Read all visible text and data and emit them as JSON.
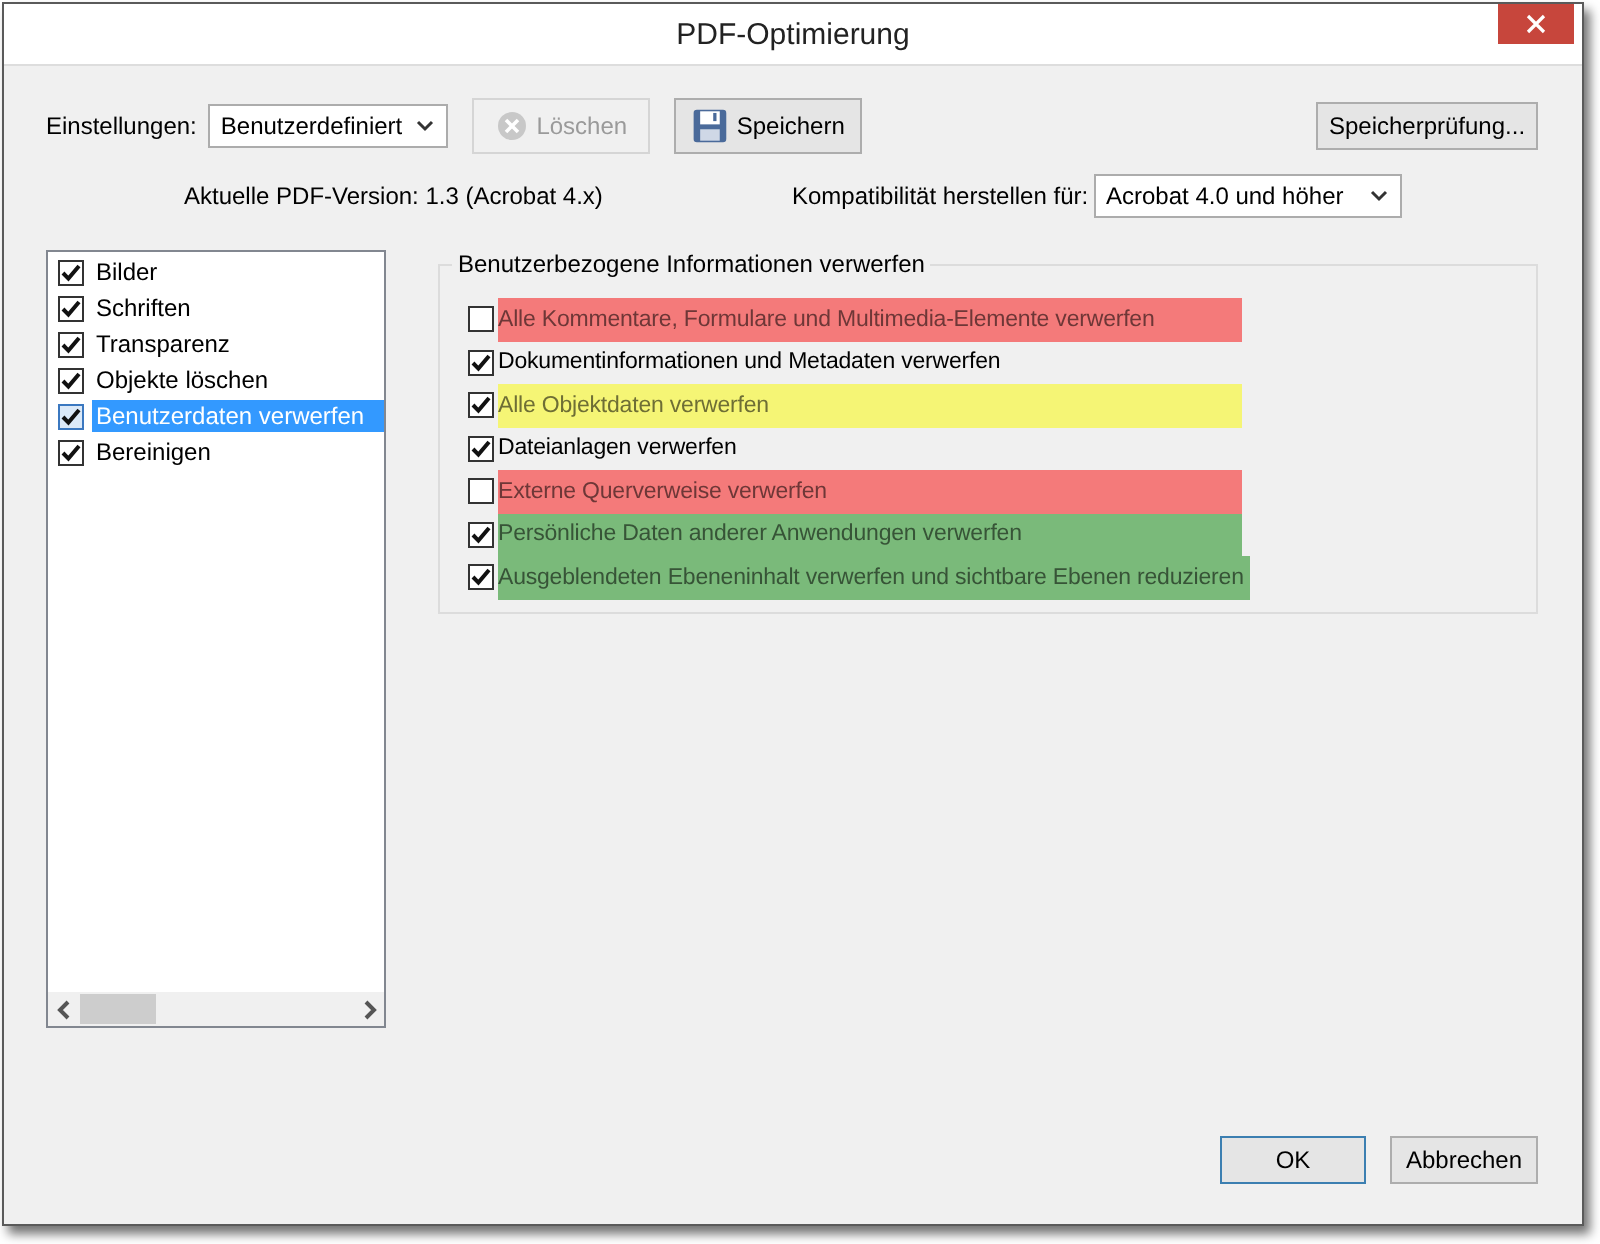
{
  "window": {
    "title": "PDF-Optimierung"
  },
  "settings": {
    "label": "Einstellungen:",
    "value": "Benutzerdefiniert"
  },
  "toolbar_buttons": [
    {
      "label": "Löschen",
      "kind": "delete",
      "disabled": true
    },
    {
      "label": "Speichern",
      "kind": "save",
      "disabled": false
    }
  ],
  "memory_button": "Speicherprüfung...",
  "pdf_version": "Aktuelle PDF-Version: 1.3 (Acrobat 4.x)",
  "compatibility": {
    "label": "Kompatibilität herstellen für:",
    "value": "Acrobat 4.0 und höher"
  },
  "categories": [
    {
      "label": "Bilder",
      "checked": true,
      "selected": false
    },
    {
      "label": "Schriften",
      "checked": true,
      "selected": false
    },
    {
      "label": "Transparenz",
      "checked": true,
      "selected": false
    },
    {
      "label": "Objekte löschen",
      "checked": true,
      "selected": false
    },
    {
      "label": "Benutzerdaten verwerfen",
      "checked": true,
      "selected": true
    },
    {
      "label": "Bereinigen",
      "checked": true,
      "selected": false
    }
  ],
  "panel": {
    "title": "Benutzerbezogene Informationen verwerfen",
    "options": [
      {
        "label": "Alle Kommentare, Formulare und Multimedia-Elemente verwerfen",
        "checked": false,
        "color": "#f47a7a"
      },
      {
        "label": "Dokumentinformationen und Metadaten verwerfen",
        "checked": true
      },
      {
        "label": "Alle Objektdaten verwerfen",
        "checked": true,
        "color": "#f5f575"
      },
      {
        "label": "Dateianlagen verwerfen",
        "checked": true
      },
      {
        "label": "Externe Querverweise verwerfen",
        "checked": false,
        "color": "#f47a7a"
      },
      {
        "label": "Persönliche Daten anderer Anwendungen verwerfen",
        "checked": true,
        "color": "#7aba7a"
      },
      {
        "label": "Ausgeblendeten Ebeneninhalt verwerfen und sichtbare Ebenen reduzieren",
        "checked": true,
        "color": "#7aba7a"
      }
    ]
  },
  "buttons": [
    {
      "label": "OK",
      "kind": "default"
    },
    {
      "label": "Abbrechen",
      "kind": "normal"
    }
  ]
}
